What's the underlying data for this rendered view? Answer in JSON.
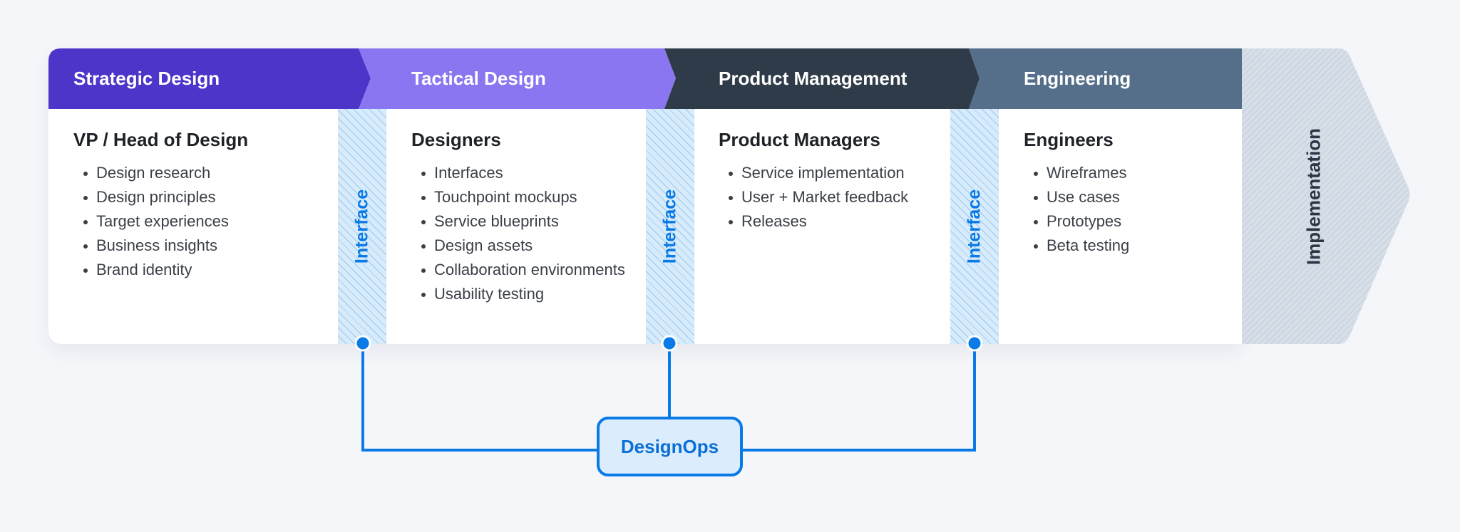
{
  "colors": {
    "strategic": "#4c35c8",
    "tactical": "#8a76f0",
    "product": "#2f3b48",
    "engineering": "#556f8a",
    "implementation": "#d6dee7",
    "interface_bg": "#d6ebfb",
    "accent": "#0a7ae6"
  },
  "stages": [
    {
      "title": "Strategic Design",
      "role": "VP / Head of Design",
      "items": [
        "Design research",
        "Design principles",
        "Target experiences",
        "Business insights",
        "Brand identity"
      ]
    },
    {
      "title": "Tactical Design",
      "role": "Designers",
      "items": [
        "Interfaces",
        "Touchpoint mockups",
        "Service blueprints",
        "Design assets",
        "Collaboration environments",
        "Usability testing"
      ]
    },
    {
      "title": "Product Management",
      "role": "Product Managers",
      "items": [
        "Service implementation",
        "User + Market feedback",
        "Releases"
      ]
    },
    {
      "title": "Engineering",
      "role": "Engineers",
      "items": [
        "Wireframes",
        "Use cases",
        "Prototypes",
        "Beta testing"
      ]
    }
  ],
  "interfaces": [
    {
      "label": "Interface"
    },
    {
      "label": "Interface"
    },
    {
      "label": "Interface"
    }
  ],
  "implementation": {
    "label": "Implementation"
  },
  "designops": {
    "label": "DesignOps"
  }
}
